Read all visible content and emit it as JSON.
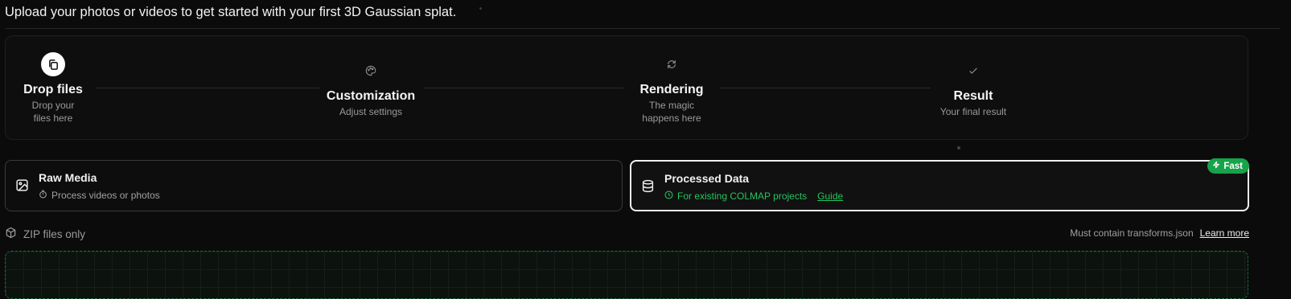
{
  "intro": "Upload your photos or videos to get started with your first 3D Gaussian splat.",
  "steps": [
    {
      "title": "Drop files",
      "desc": "Drop your files here",
      "icon": "copy-icon",
      "active": true
    },
    {
      "title": "Customization",
      "desc": "Adjust settings",
      "icon": "palette-icon",
      "active": false
    },
    {
      "title": "Rendering",
      "desc": "The magic happens here",
      "icon": "rotate-icon",
      "active": false
    },
    {
      "title": "Result",
      "desc": "Your final result",
      "icon": "check-icon",
      "active": false
    }
  ],
  "cards": {
    "raw": {
      "title": "Raw Media",
      "subtitle": "Process videos or photos",
      "icon": "image-icon",
      "sub_icon": "timer-icon"
    },
    "processed": {
      "title": "Processed Data",
      "subtitle": "For existing COLMAP projects",
      "guide": "Guide",
      "badge": "Fast",
      "icon": "database-icon",
      "sub_icon": "clock-icon",
      "selected": true
    }
  },
  "upload": {
    "format_note": "ZIP files only",
    "requirement": "Must contain transforms.json",
    "learn_more": "Learn more"
  },
  "colors": {
    "accent": "#22c55e",
    "badge": "#16a34a",
    "background": "#0b0b0b"
  }
}
